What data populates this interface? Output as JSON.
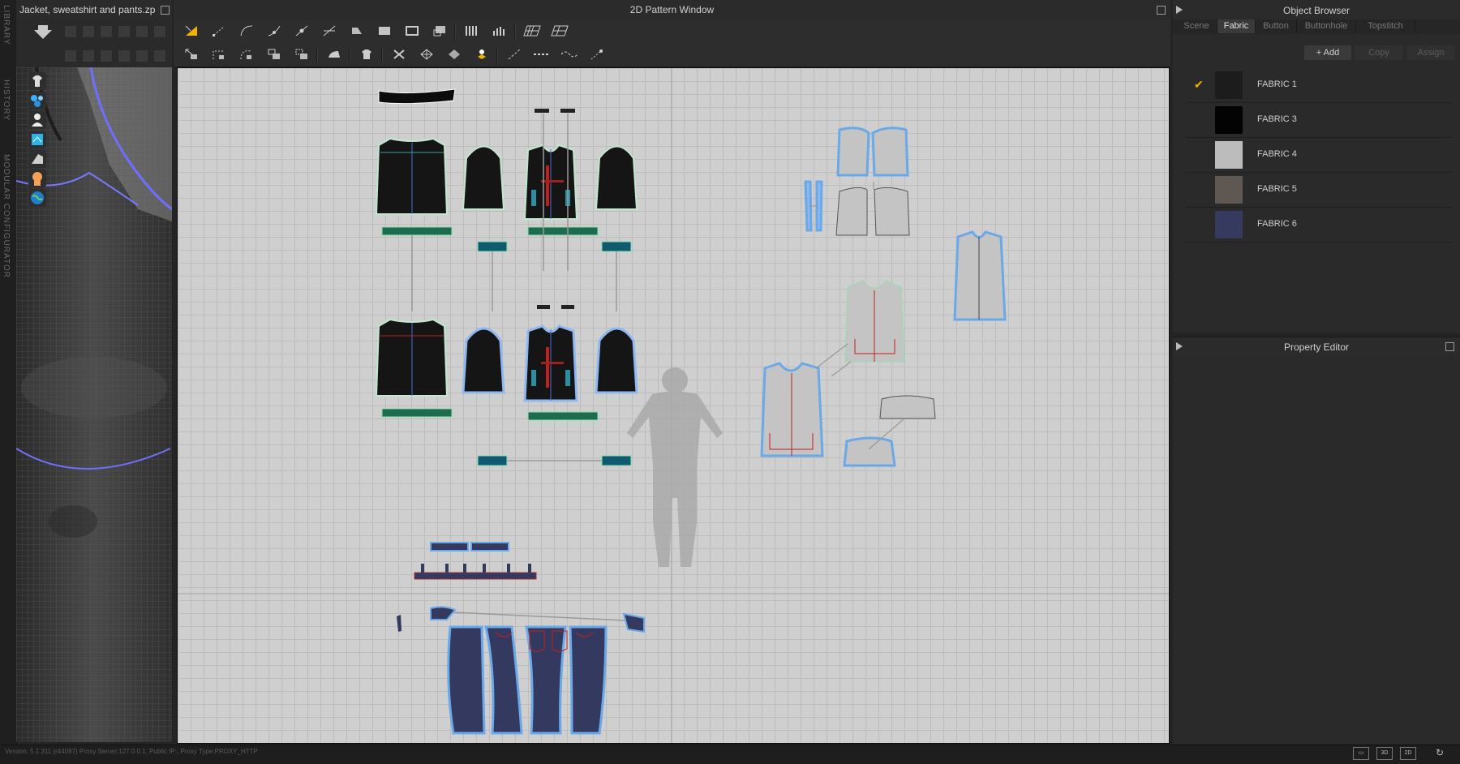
{
  "left_strip": {
    "library": "LIBRARY",
    "history": "HISTORY",
    "modular": "MODULAR CONFIGURATOR"
  },
  "viewport3d": {
    "title": "Jacket, sweatshirt and pants.zprj"
  },
  "pattern2d": {
    "title": "2D Pattern Window"
  },
  "object_browser": {
    "title": "Object Browser",
    "tabs": [
      "Scene",
      "Fabric",
      "Button",
      "Buttonhole",
      "Topstitch"
    ],
    "active_tab": "Fabric",
    "actions": {
      "add": "+ Add",
      "copy": "Copy",
      "assign": "Assign"
    },
    "fabrics": [
      {
        "name": "FABRIC 1",
        "color": "#1c1c1c",
        "selected": true
      },
      {
        "name": "FABRIC 3",
        "color": "#030303",
        "selected": false
      },
      {
        "name": "FABRIC 4",
        "color": "#bcbcbc",
        "selected": false
      },
      {
        "name": "FABRIC 5",
        "color": "#5e5752",
        "selected": false
      },
      {
        "name": "FABRIC 6",
        "color": "#353a5e",
        "selected": false
      }
    ]
  },
  "property_editor": {
    "title": "Property Editor"
  },
  "status": {
    "text": "Version: 5.1.311 (r44087)    Proxy Server:127.0.0.1, Public IP:, Proxy Type:PROXY_HTTP"
  },
  "view_buttons": {
    "btn3d": "3D",
    "btn2d": "2D"
  },
  "colors": {
    "accent": "#f0b400",
    "seam_blue": "#5b8ff0",
    "pants": "#343a5f",
    "jacket": "#151515",
    "pattern_gray": "#bdbdbd"
  }
}
